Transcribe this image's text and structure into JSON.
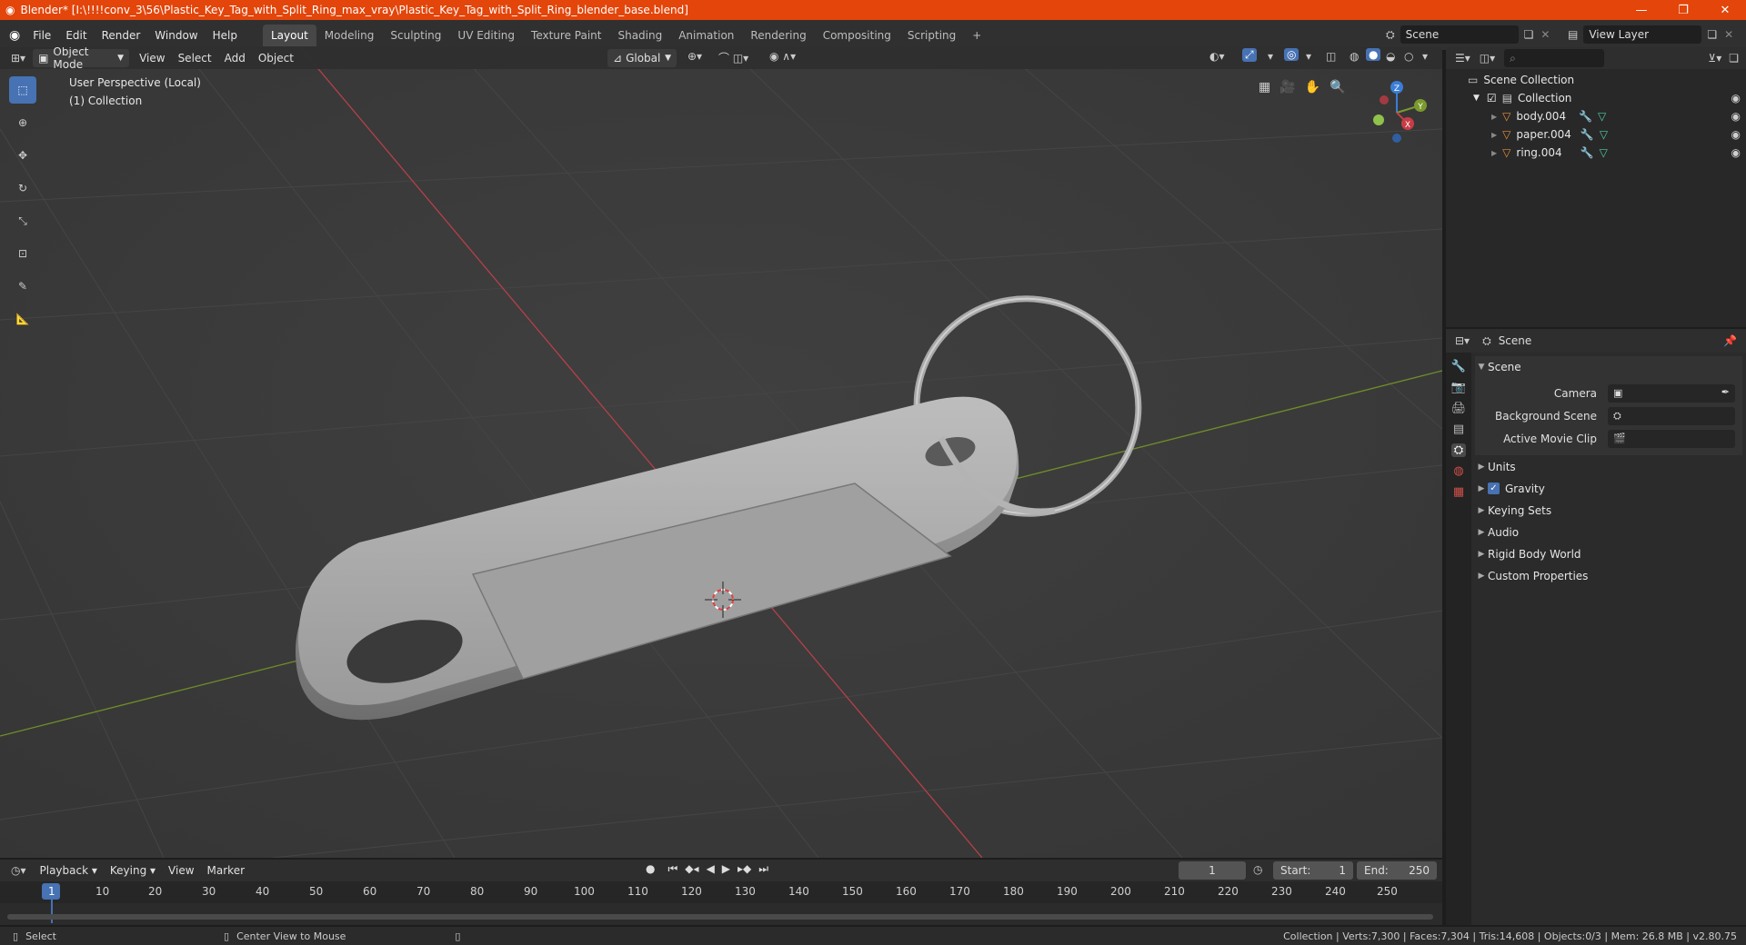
{
  "titlebar": {
    "title": "Blender* [I:\\!!!!conv_3\\56\\Plastic_Key_Tag_with_Split_Ring_max_vray\\Plastic_Key_Tag_with_Split_Ring_blender_base.blend]",
    "minimize": "—",
    "restore": "❐",
    "close": "✕"
  },
  "menu": [
    "File",
    "Edit",
    "Render",
    "Window",
    "Help"
  ],
  "workspaces": [
    "Layout",
    "Modeling",
    "Sculpting",
    "UV Editing",
    "Texture Paint",
    "Shading",
    "Animation",
    "Rendering",
    "Compositing",
    "Scripting"
  ],
  "workspace_add": "+",
  "scene_field": "Scene",
  "viewlayer_field": "View Layer",
  "viewport_header": {
    "mode": "Object Mode",
    "menus": [
      "View",
      "Select",
      "Add",
      "Object"
    ],
    "orientation": "Global"
  },
  "viewport": {
    "perspective_label": "User Perspective (Local)",
    "collection_label": "(1) Collection",
    "gizmo": {
      "x": "X",
      "y": "Y",
      "z": "Z"
    }
  },
  "outliner": {
    "root": "Scene Collection",
    "collection": "Collection",
    "items": [
      "body.004",
      "paper.004",
      "ring.004"
    ]
  },
  "properties": {
    "header": "Scene",
    "section": "Scene",
    "fields": [
      {
        "label": "Camera"
      },
      {
        "label": "Background Scene"
      },
      {
        "label": "Active Movie Clip"
      }
    ],
    "panels": [
      "Units",
      "Gravity",
      "Keying Sets",
      "Audio",
      "Rigid Body World",
      "Custom Properties"
    ]
  },
  "timeline": {
    "menus": [
      "Playback",
      "Keying",
      "View",
      "Marker"
    ],
    "current_frame": "1",
    "start_label": "Start:",
    "start": "1",
    "end_label": "End:",
    "end": "250",
    "ticks": [
      "1",
      "10",
      "20",
      "30",
      "40",
      "50",
      "60",
      "70",
      "80",
      "90",
      "100",
      "110",
      "120",
      "130",
      "140",
      "150",
      "160",
      "170",
      "180",
      "190",
      "200",
      "210",
      "220",
      "230",
      "240",
      "250"
    ]
  },
  "statusbar": {
    "select": "Select",
    "center": "Center View to Mouse",
    "stats": "Collection | Verts:7,300 | Faces:7,304 | Tris:14,608 | Objects:0/3 | Mem: 26.8 MB | v2.80.75"
  },
  "colors": {
    "title_bg": "#e3450a",
    "accent": "#4772b3",
    "x_axis": "#c83c46",
    "y_axis": "#7a9a2e",
    "object_orange": "#e8913a"
  }
}
